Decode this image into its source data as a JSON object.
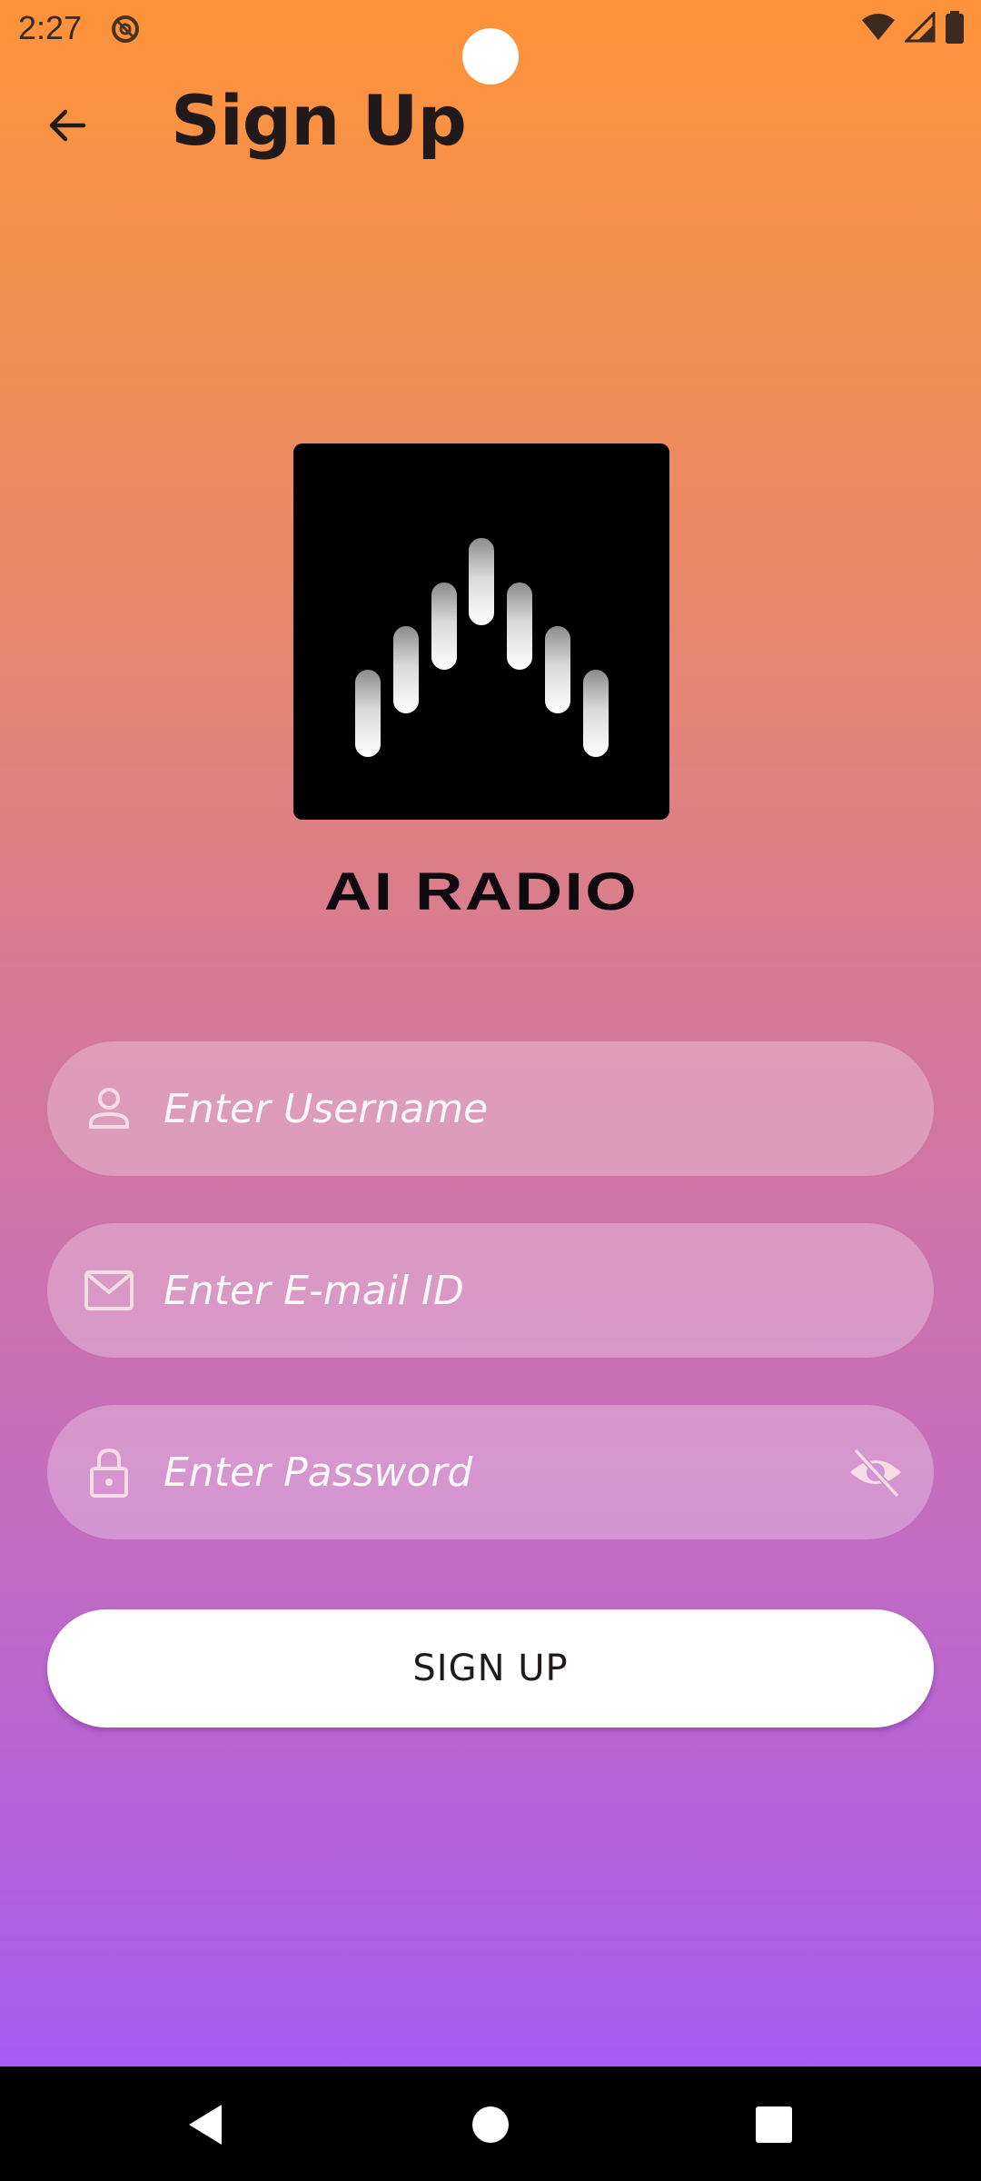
{
  "status_bar": {
    "time": "2:27",
    "icons": [
      "notification-icon",
      "wifi-icon",
      "signal-icon",
      "battery-icon"
    ]
  },
  "app_bar": {
    "title": "Sign Up",
    "back_icon": "arrow-back-icon"
  },
  "logo": {
    "brand_name": "AI RADIO"
  },
  "form": {
    "username": {
      "placeholder": "Enter Username",
      "value": "",
      "icon": "person-icon"
    },
    "email": {
      "placeholder": "Enter E-mail ID",
      "value": "",
      "icon": "mail-icon"
    },
    "password": {
      "placeholder": "Enter Password",
      "value": "",
      "icon": "lock-icon",
      "toggle_icon": "eye-off-icon"
    },
    "submit_label": "SIGN UP"
  },
  "nav_bar": {
    "items": [
      "back-triangle-icon",
      "home-circle-icon",
      "recents-square-icon"
    ]
  },
  "colors": {
    "gradient_top": "#fd933a",
    "gradient_bottom": "#a65cf3",
    "button_bg": "#ffffff",
    "logo_bg": "#000000"
  }
}
